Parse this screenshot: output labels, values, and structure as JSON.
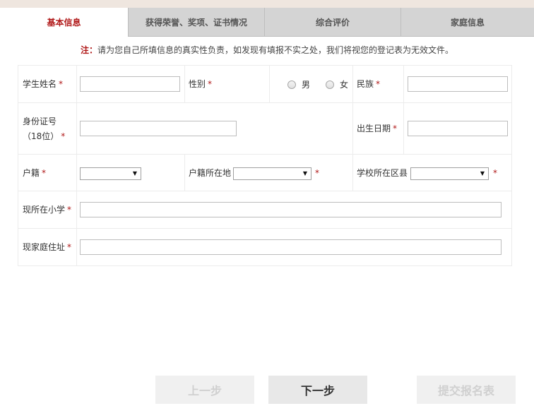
{
  "tabs": [
    {
      "label": "基本信息",
      "active": true
    },
    {
      "label": "获得荣誉、奖项、证书情况",
      "active": false
    },
    {
      "label": "综合评价",
      "active": false
    },
    {
      "label": "家庭信息",
      "active": false
    }
  ],
  "note": {
    "label": "注：",
    "text": "请为您自己所填信息的真实性负责，如发现有填报不实之处，我们将视您的登记表为无效文件。"
  },
  "form": {
    "required_mark": "*",
    "student_name": {
      "label": "学生姓名",
      "value": ""
    },
    "gender": {
      "label": "性别",
      "options": [
        "男",
        "女"
      ],
      "selected": ""
    },
    "ethnicity": {
      "label": "民族",
      "value": ""
    },
    "id_number": {
      "label_line1": "身份证号",
      "label_line2": "（18位）",
      "value": ""
    },
    "birth_date": {
      "label": "出生日期",
      "value": ""
    },
    "hukou": {
      "label": "户籍",
      "value": ""
    },
    "hukou_location": {
      "label": "户籍所在地",
      "value": ""
    },
    "school_district": {
      "label": "学校所在区县",
      "value": ""
    },
    "current_school": {
      "label": "现所在小学",
      "value": ""
    },
    "home_address": {
      "label": "现家庭住址",
      "value": ""
    }
  },
  "buttons": {
    "prev": "上一步",
    "next": "下一步",
    "submit": "提交报名表"
  },
  "icons": {
    "dropdown": "chevron-down-icon"
  },
  "colors": {
    "accent": "#b01818",
    "tab_inactive_bg": "#d4d4d4",
    "border": "#ececec"
  }
}
